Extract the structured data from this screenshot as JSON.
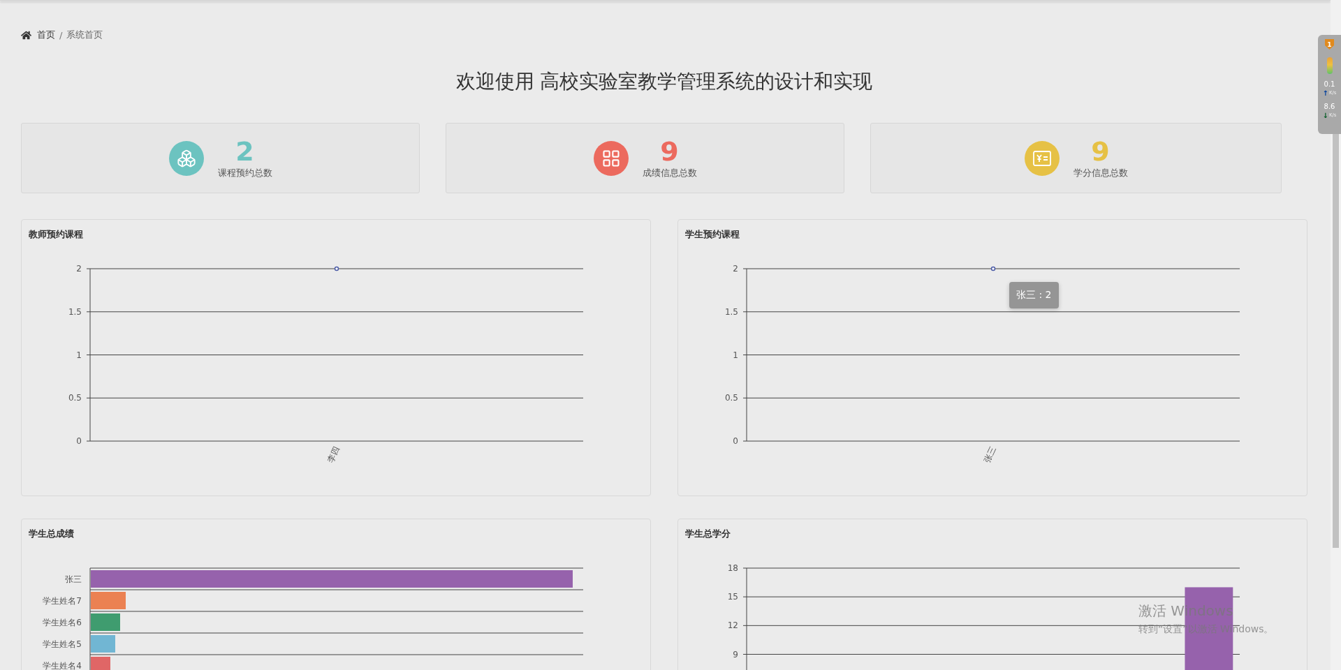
{
  "breadcrumb": {
    "items": [
      {
        "label": "首页",
        "selected": false
      },
      {
        "label": "系统首页",
        "selected": true
      }
    ],
    "separator": "/"
  },
  "title": "欢迎使用 高校实验室教学管理系统的设计和实现",
  "stats": [
    {
      "kind": "boxes",
      "value": "2",
      "label": "课程预约总数",
      "color": "#6cc3c0"
    },
    {
      "kind": "grid",
      "value": "9",
      "label": "成绩信息总数",
      "color": "#ec6a5e"
    },
    {
      "kind": "money",
      "value": "9",
      "label": "学分信息总数",
      "color": "#e6c145"
    }
  ],
  "panels": [
    {
      "kind": "line",
      "title": "教师预约课程",
      "chart_data": {
        "type": "line",
        "categories": [
          "李四"
        ],
        "series": [
          {
            "color": "#4e5ea8",
            "values": [
              2
            ],
            "marker": true
          }
        ],
        "ylim": [
          0,
          2
        ],
        "yticks": [
          0,
          0.5,
          1,
          1.5,
          2
        ],
        "grid": true
      }
    },
    {
      "kind": "line",
      "title": "学生预约课程",
      "chart_data": {
        "type": "line",
        "categories": [
          "张三"
        ],
        "series": [
          {
            "color": "#4e5ea8",
            "values": [
              2
            ],
            "marker": true
          }
        ],
        "ylim": [
          0,
          2
        ],
        "yticks": [
          0,
          0.5,
          1,
          1.5,
          2
        ],
        "grid": true
      },
      "tooltip": "张三 : 2"
    },
    {
      "kind": "hbar",
      "title": "学生总成绩",
      "rows": [
        {
          "label": "张三",
          "color": "#9662ac"
        },
        {
          "label": "学生姓名7",
          "color": "#eb8152"
        },
        {
          "label": "学生姓名6",
          "color": "#3f9c6f"
        },
        {
          "label": "学生姓名5",
          "color": "#71b6d3"
        },
        {
          "label": "学生姓名4",
          "color": "#e06666"
        }
      ]
    },
    {
      "kind": "bar",
      "title": "学生总学分",
      "chart_data": {
        "type": "bar",
        "series": [
          {
            "color": "#9662ac",
            "values": [
              null,
              null,
              null,
              null,
              null,
              null,
              null,
              16
            ]
          }
        ],
        "ylim": [
          0,
          18
        ],
        "yticks": [
          {
            "value": 9,
            "label": "9"
          },
          {
            "value": 12,
            "label": "12"
          },
          {
            "value": 15,
            "label": "15"
          },
          {
            "value": 18,
            "label": "18"
          }
        ],
        "grid": true
      }
    }
  ],
  "tray": {
    "badge": "1",
    "upload": {
      "value": "0.1",
      "arrow": "↑",
      "unit": "K/s"
    },
    "download": {
      "value": "8.6",
      "arrow": "↓",
      "unit": "K/s"
    }
  },
  "activation_notice": {
    "title": "激活 Windows",
    "text": "转到“设置”以激活 Windows。"
  }
}
